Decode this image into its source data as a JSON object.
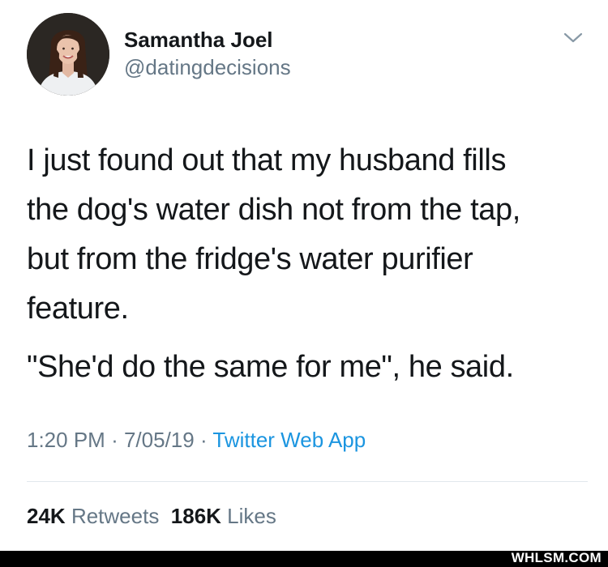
{
  "author": {
    "display_name": "Samantha Joel",
    "handle": "@datingdecisions"
  },
  "tweet": {
    "lines": [
      "I just found out that my husband fills",
      "the dog's water dish not from the tap,",
      "but from the fridge's water purifier",
      "feature."
    ],
    "quote": "\"She'd do the same for me\", he said."
  },
  "meta": {
    "time": "1:20 PM",
    "date": "7/05/19",
    "separator": "·",
    "source": "Twitter Web App"
  },
  "stats": {
    "retweets_count": "24K",
    "retweets_label": "Retweets",
    "likes_count": "186K",
    "likes_label": "Likes"
  },
  "watermark": "WHLSM.COM",
  "colors": {
    "text": "#14171a",
    "secondary": "#657786",
    "link": "#1b95e0",
    "divider": "#e1e8ed"
  },
  "icons": {
    "menu": "chevron-down-icon"
  }
}
